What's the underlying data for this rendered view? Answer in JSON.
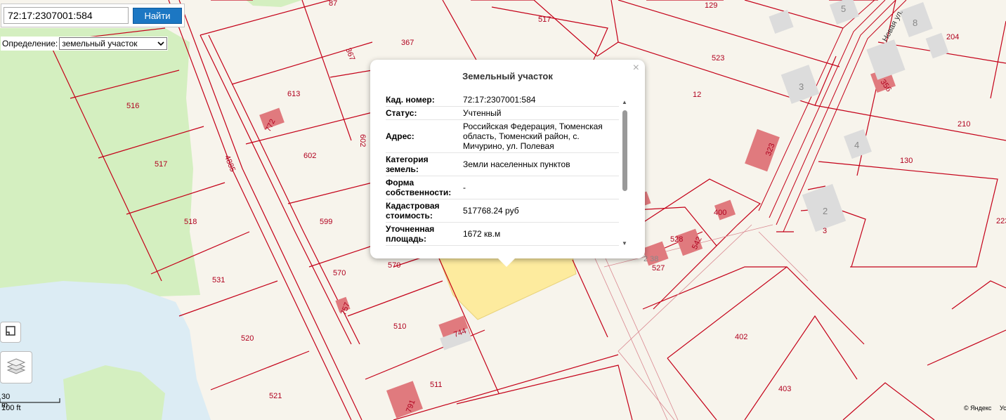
{
  "search": {
    "value": "72:17:2307001:584",
    "button_label": "Найти"
  },
  "definition": {
    "label": "Определение:",
    "selected": "земельный участок"
  },
  "popup": {
    "title": "Земельный участок",
    "close_glyph": "×",
    "rows": [
      {
        "key": "Кад. номер:",
        "value": "72:17:2307001:584"
      },
      {
        "key": "Статус:",
        "value": "Учтенный"
      },
      {
        "key": "Адрес:",
        "value": "Российская Федерация, Тюменская область, Тюменский район, с. Мичурино, ул. Полевая"
      },
      {
        "key": "Категория земель:",
        "value": "Земли населенных пунктов"
      },
      {
        "key": "Форма собственности:",
        "value": "-"
      },
      {
        "key": "Кадастровая стоимость:",
        "value": "517768.24 руб"
      },
      {
        "key": "Уточненная площадь:",
        "value": "1672 кв.м"
      }
    ]
  },
  "scale": {
    "metric": "30 m",
    "imperial": "100 ft"
  },
  "attribution": {
    "text": "© Яндекс",
    "link": "Ус"
  },
  "map_labels": {
    "l87": "87",
    "l517a": "517",
    "l129": "129",
    "l5": "5",
    "l8": "8",
    "l204": "204",
    "l367a": "367",
    "l367b": "367",
    "l523": "523",
    "l3a": "3",
    "l356": "356",
    "l516": "516",
    "l613": "613",
    "l12": "12",
    "l210": "210",
    "l772": "772",
    "l602a": "602",
    "l602b": "602",
    "l323": "323",
    "l4": "4",
    "l4885": "4885",
    "l517b": "517",
    "l130": "130",
    "l2": "2",
    "l3b": "3",
    "l400": "400",
    "l599": "599",
    "l518": "518",
    "l223": "223",
    "l528": "528",
    "l542": "542",
    "l527": "527",
    "l238": "2 38",
    "l570a": "570",
    "l570b": "570",
    "l531": "531",
    "l757": "757",
    "l510": "510",
    "l744": "744",
    "l402": "402",
    "l520": "520",
    "l511": "511",
    "l403": "403",
    "l521": "521",
    "l791": "791",
    "street": "Новая ул."
  },
  "colors": {
    "boundary": "#c40018",
    "forest": "#d4efc0",
    "water": "#dcecf4",
    "building": "#e07a7e",
    "building_gray": "#dcdcdc",
    "highlight": "#fdeb9e",
    "accent": "#1c77c3"
  }
}
